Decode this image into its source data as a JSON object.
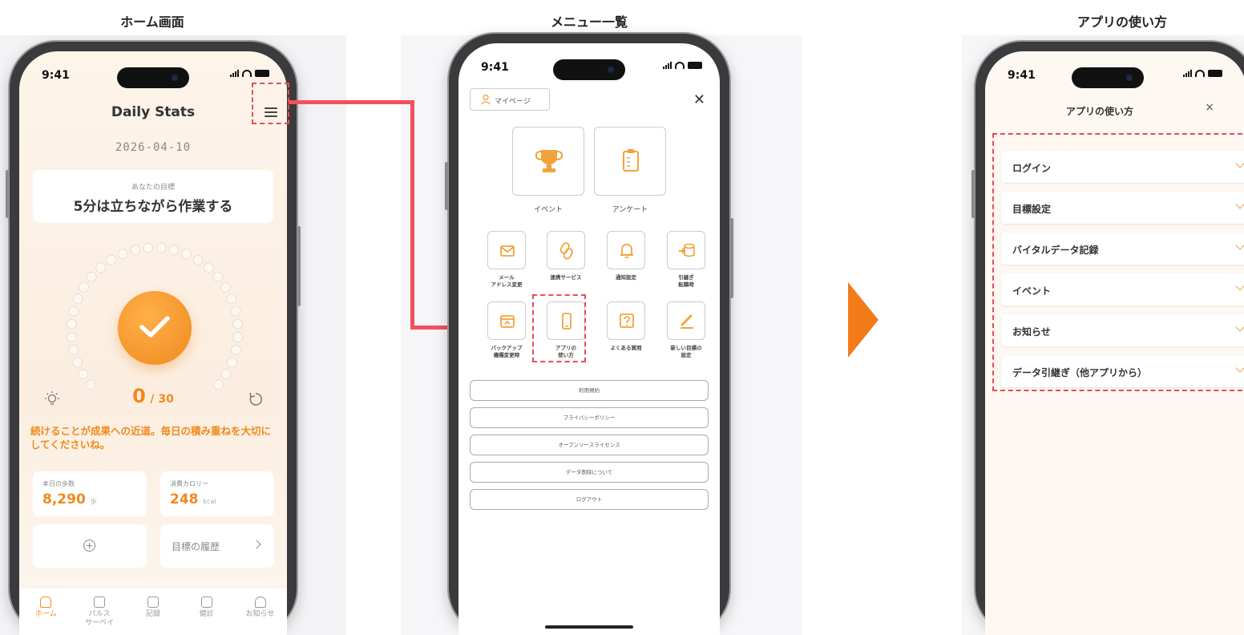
{
  "sections": {
    "home_title": "ホーム画面",
    "menu_title": "メニュー一覧",
    "howto_title": "アプリの使い方"
  },
  "status_time": "9:41",
  "home": {
    "title": "Daily Stats",
    "date": "2026-04-10",
    "goal_label": "あなたの目標",
    "goal_text": "5分は立ちながら作業する",
    "count_current": "0",
    "count_total": "/ 30",
    "progress_done": 0,
    "progress_total": 30,
    "motivation": "続けることが成果への近道。毎日の積み重ねを大切にしてくださいね。",
    "steps_label": "本日の歩数",
    "steps_value": "8,290",
    "steps_unit": "歩",
    "cal_label": "消費カロリー",
    "cal_value": "248",
    "cal_unit": "kcal",
    "history_label": "目標の履歴",
    "tabs": [
      {
        "label": "ホーム"
      },
      {
        "label": "パルス\nサーベイ"
      },
      {
        "label": "記録"
      },
      {
        "label": "健診"
      },
      {
        "label": "お知らせ"
      }
    ]
  },
  "menu": {
    "mypage": "マイページ",
    "close": "✕",
    "big_tiles": [
      {
        "label": "イベント"
      },
      {
        "label": "アンケート"
      }
    ],
    "row1": [
      {
        "label": "メール\nアドレス変更"
      },
      {
        "label": "連携サービス"
      },
      {
        "label": "通知設定"
      },
      {
        "label": "引継ぎ\n転職時"
      }
    ],
    "row2": [
      {
        "label": "バックアップ\n機種変更時"
      },
      {
        "label": "アプリの\n使い方"
      },
      {
        "label": "よくある質問"
      },
      {
        "label": "新しい目標の\n設定"
      }
    ],
    "list": [
      "利用規約",
      "プライバシーポリシー",
      "オープンソースライセンス",
      "データ削除について",
      "ログアウト"
    ]
  },
  "howto": {
    "title": "アプリの使い方",
    "close": "×",
    "items": [
      "ログイン",
      "目標設定",
      "バイタルデータ記録",
      "イベント",
      "お知らせ",
      "データ引継ぎ（他アプリから）"
    ]
  },
  "colors": {
    "accent": "#f08a1d",
    "highlight": "#e94b5a",
    "arrow": "#f1515e",
    "triangle": "#f47b1a"
  }
}
